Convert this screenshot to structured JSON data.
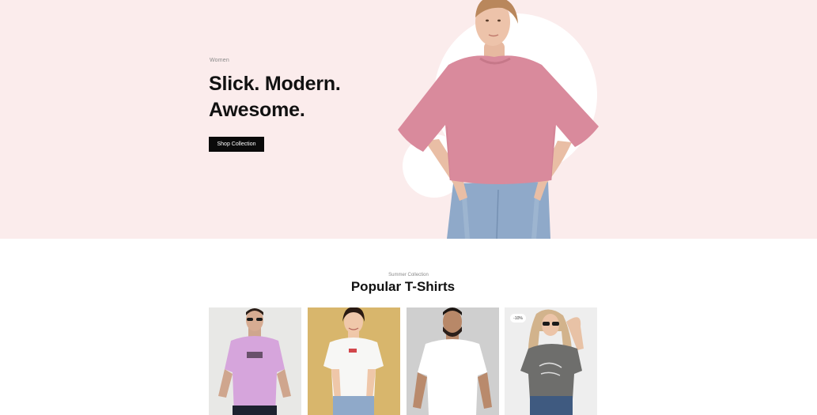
{
  "hero": {
    "eyebrow": "Women",
    "title_line1": "Slick. Modern.",
    "title_line2": "Awesome.",
    "cta_label": "Shop Collection"
  },
  "collection": {
    "eyebrow": "Summer Collection",
    "title": "Popular T-Shirts"
  },
  "products": [
    {
      "shirt_color": "#d6a5dc",
      "background": "#e8e8e6"
    },
    {
      "shirt_color": "#f7f7f5",
      "background": "#d8b66c"
    },
    {
      "shirt_color": "#ffffff",
      "background": "#cfcfcf"
    },
    {
      "shirt_color": "#6e6e6c",
      "background": "#eeeeee",
      "badge": "-10%"
    }
  ],
  "colors": {
    "hero_background": "#fbecec",
    "hero_shirt": "#d98a9c",
    "button": "#0a0a0a"
  }
}
